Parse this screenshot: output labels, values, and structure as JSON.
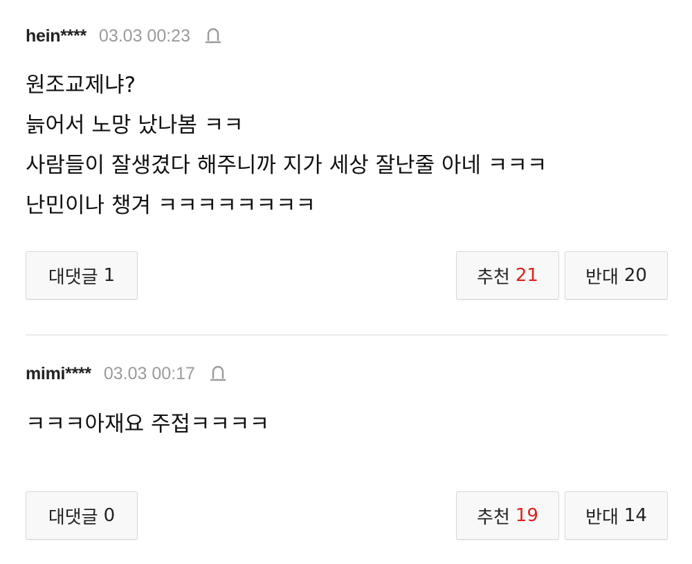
{
  "comments": [
    {
      "author": "hein****",
      "time": "03.03 00:23",
      "lines": [
        "원조교제냐?",
        "늙어서 노망 났나봄 ㅋㅋ",
        "사람들이 잘생겼다 해주니까 지가 세상 잘난줄 아네 ㅋㅋㅋ",
        "난민이나 챙겨 ㅋㅋㅋㅋㅋㅋㅋㅋ"
      ],
      "reply_label": "대댓글",
      "reply_count": "1",
      "recommend_label": "추천",
      "recommend_count": "21",
      "oppose_label": "반대",
      "oppose_count": "20"
    },
    {
      "author": "mimi****",
      "time": "03.03 00:17",
      "lines": [
        "ㅋㅋㅋ아재요 주접ㅋㅋㅋㅋ"
      ],
      "reply_label": "대댓글",
      "reply_count": "0",
      "recommend_label": "추천",
      "recommend_count": "19",
      "oppose_label": "반대",
      "oppose_count": "14"
    }
  ],
  "icons": {
    "report": "siren-report-icon"
  },
  "colors": {
    "recommend_count": "#e0201d",
    "meta_time": "#9a9a9a",
    "divider": "#ececec"
  }
}
